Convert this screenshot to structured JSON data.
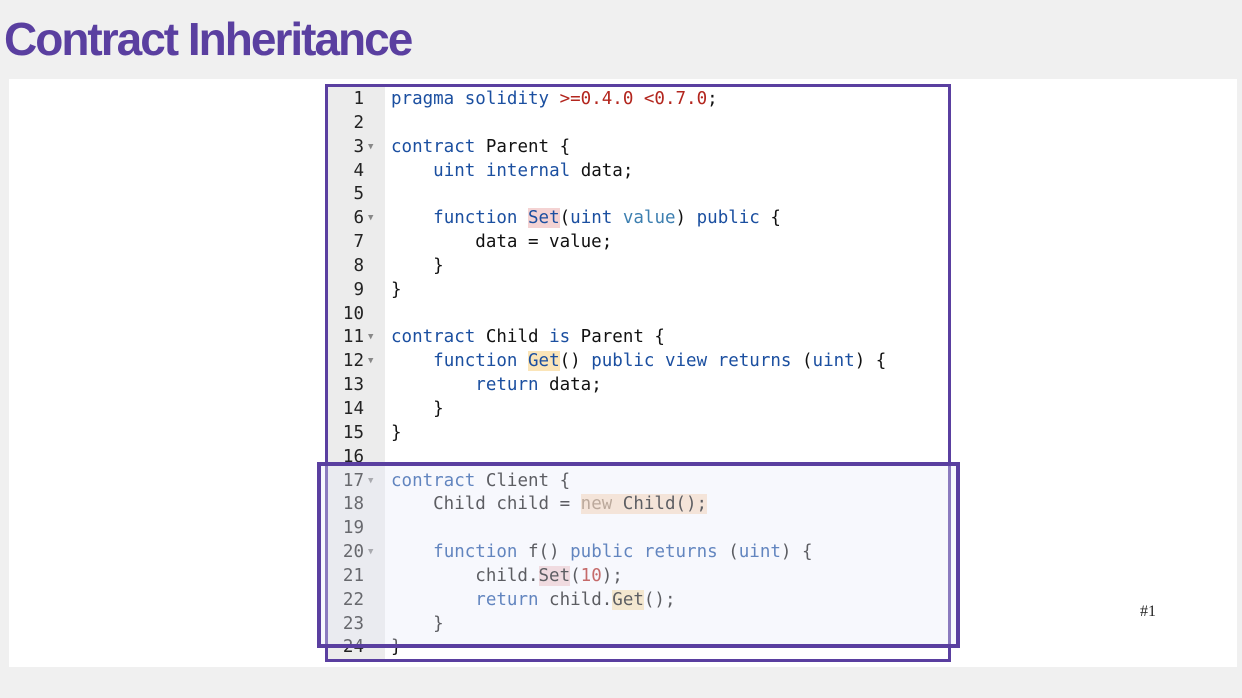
{
  "slide": {
    "title": "Contract Inheritance",
    "number": "#1"
  },
  "editor": {
    "lines": [
      {
        "n": "1",
        "fold": "",
        "segments": [
          {
            "t": "pragma",
            "c": "kw"
          },
          {
            "t": " "
          },
          {
            "t": "solidity",
            "c": "kw"
          },
          {
            "t": " "
          },
          {
            "t": ">=0.4.0 <0.7.0",
            "c": "num"
          },
          {
            "t": ";"
          }
        ]
      },
      {
        "n": "2",
        "fold": "",
        "segments": []
      },
      {
        "n": "3",
        "fold": "▼",
        "segments": [
          {
            "t": "contract",
            "c": "kw"
          },
          {
            "t": " Parent {"
          }
        ]
      },
      {
        "n": "4",
        "fold": "",
        "segments": [
          {
            "t": "    "
          },
          {
            "t": "uint",
            "c": "kw"
          },
          {
            "t": " "
          },
          {
            "t": "internal",
            "c": "kw"
          },
          {
            "t": " data;"
          }
        ]
      },
      {
        "n": "5",
        "fold": "",
        "segments": []
      },
      {
        "n": "6",
        "fold": "▼",
        "segments": [
          {
            "t": "    "
          },
          {
            "t": "function",
            "c": "kw"
          },
          {
            "t": " "
          },
          {
            "t": "Set",
            "c": "kw hl-red"
          },
          {
            "t": "("
          },
          {
            "t": "uint",
            "c": "kw"
          },
          {
            "t": " "
          },
          {
            "t": "value",
            "c": "par"
          },
          {
            "t": ") "
          },
          {
            "t": "public",
            "c": "kw"
          },
          {
            "t": " {"
          }
        ]
      },
      {
        "n": "7",
        "fold": "",
        "segments": [
          {
            "t": "        data = value;"
          }
        ]
      },
      {
        "n": "8",
        "fold": "",
        "segments": [
          {
            "t": "    }"
          }
        ]
      },
      {
        "n": "9",
        "fold": "",
        "segments": [
          {
            "t": "}"
          }
        ]
      },
      {
        "n": "10",
        "fold": "",
        "segments": []
      },
      {
        "n": "11",
        "fold": "▼",
        "segments": [
          {
            "t": "contract",
            "c": "kw"
          },
          {
            "t": " Child "
          },
          {
            "t": "is",
            "c": "kw"
          },
          {
            "t": " Parent {"
          }
        ]
      },
      {
        "n": "12",
        "fold": "▼",
        "segments": [
          {
            "t": "    "
          },
          {
            "t": "function",
            "c": "kw"
          },
          {
            "t": " "
          },
          {
            "t": "Get",
            "c": "kw hl-yel"
          },
          {
            "t": "() "
          },
          {
            "t": "public",
            "c": "kw"
          },
          {
            "t": " "
          },
          {
            "t": "view",
            "c": "kw"
          },
          {
            "t": " "
          },
          {
            "t": "returns",
            "c": "kw"
          },
          {
            "t": " ("
          },
          {
            "t": "uint",
            "c": "kw"
          },
          {
            "t": ") {"
          }
        ]
      },
      {
        "n": "13",
        "fold": "",
        "segments": [
          {
            "t": "        "
          },
          {
            "t": "return",
            "c": "kw"
          },
          {
            "t": " data;"
          }
        ]
      },
      {
        "n": "14",
        "fold": "",
        "segments": [
          {
            "t": "    }"
          }
        ]
      },
      {
        "n": "15",
        "fold": "",
        "segments": [
          {
            "t": "}"
          }
        ]
      },
      {
        "n": "16",
        "fold": "",
        "segments": []
      },
      {
        "n": "17",
        "fold": "▼",
        "segments": [
          {
            "t": "contract",
            "c": "kw"
          },
          {
            "t": " Client {"
          }
        ]
      },
      {
        "n": "18",
        "fold": "",
        "segments": [
          {
            "t": "    Child child = "
          },
          {
            "t": "new",
            "c": "new hl-org"
          },
          {
            "t": " Child();",
            "c": "hl-org"
          }
        ]
      },
      {
        "n": "19",
        "fold": "",
        "segments": []
      },
      {
        "n": "20",
        "fold": "▼",
        "segments": [
          {
            "t": "    "
          },
          {
            "t": "function",
            "c": "kw"
          },
          {
            "t": " f() "
          },
          {
            "t": "public",
            "c": "kw"
          },
          {
            "t": " "
          },
          {
            "t": "returns",
            "c": "kw"
          },
          {
            "t": " ("
          },
          {
            "t": "uint",
            "c": "kw"
          },
          {
            "t": ") {"
          }
        ]
      },
      {
        "n": "21",
        "fold": "",
        "segments": [
          {
            "t": "        child."
          },
          {
            "t": "Set",
            "c": "hl-red"
          },
          {
            "t": "("
          },
          {
            "t": "10",
            "c": "num"
          },
          {
            "t": ");"
          }
        ]
      },
      {
        "n": "22",
        "fold": "",
        "segments": [
          {
            "t": "        "
          },
          {
            "t": "return",
            "c": "kw"
          },
          {
            "t": " child."
          },
          {
            "t": "Get",
            "c": "hl-yel"
          },
          {
            "t": "();"
          }
        ]
      },
      {
        "n": "23",
        "fold": "",
        "segments": [
          {
            "t": "    }"
          }
        ]
      },
      {
        "n": "24",
        "fold": "",
        "segments": [
          {
            "t": "}"
          }
        ]
      }
    ]
  },
  "colors": {
    "accent": "#5a3fa0",
    "keyword": "#1b4fa0",
    "number": "#b3261e",
    "highlight_set": "#f4d3d3",
    "highlight_get": "#fbe5b8"
  }
}
